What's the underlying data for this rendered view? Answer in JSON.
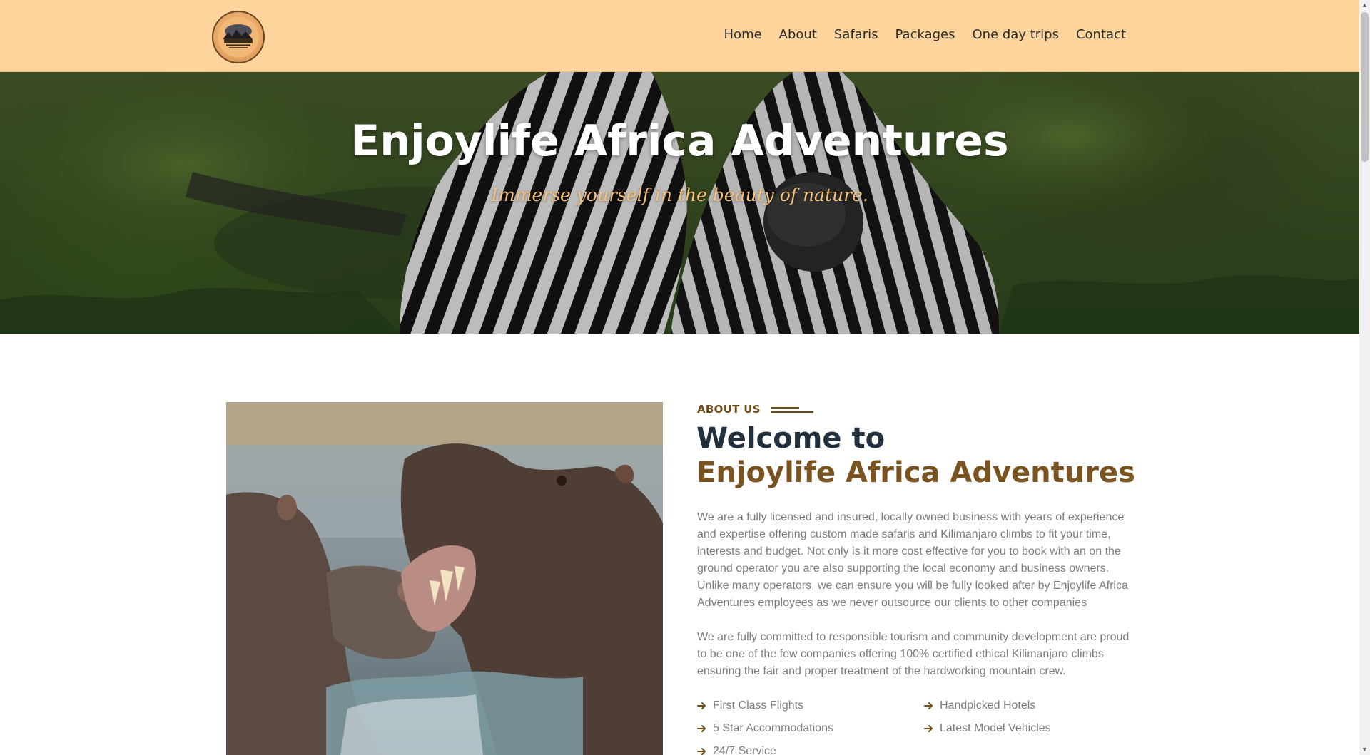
{
  "nav": {
    "logo_alt": "Enjoylife Africa Adventures",
    "links": [
      "Home",
      "About",
      "Safaris",
      "Packages",
      "One day trips",
      "Contact"
    ]
  },
  "hero": {
    "title": "Enjoylife Africa Adventures",
    "subtitle": "Immerse yourself in the beauty of nature."
  },
  "about": {
    "label": "ABOUT US",
    "heading_line1": "Welcome to",
    "heading_line2": "Enjoylife Africa Adventures",
    "paragraph1": "We are a fully licensed and insured, locally owned business with years of experience and expertise offering custom made safaris and Kilimanjaro climbs to fit your time, interests and budget. Not only is it more cost effective for you to book with an on the ground operator you are also supporting the local economy and business owners. Unlike many operators, we can ensure you will be fully looked after by Enjoylife Africa Adventures employees as we never outsource our clients to other companies",
    "paragraph2": "We are fully committed to responsible tourism and community development are proud to be one of the few companies offering 100% certified ethical Kilimanjaro climbs ensuring the fair and proper treatment of the hardworking mountain crew.",
    "features": [
      "First Class Flights",
      "Handpicked Hotels",
      "5 Star Accommodations",
      "Latest Model Vehicles",
      "24/7 Service"
    ]
  },
  "colors": {
    "navbar_bg": "#fdd59c",
    "accent_brown": "#7a5420",
    "heading_dark": "#22303e",
    "body_text": "#7c7c7c",
    "subtitle_gold": "#f6c27b"
  },
  "icons": {
    "feature_bullet": "arrow-right-icon",
    "logo": "logo-emblem"
  }
}
